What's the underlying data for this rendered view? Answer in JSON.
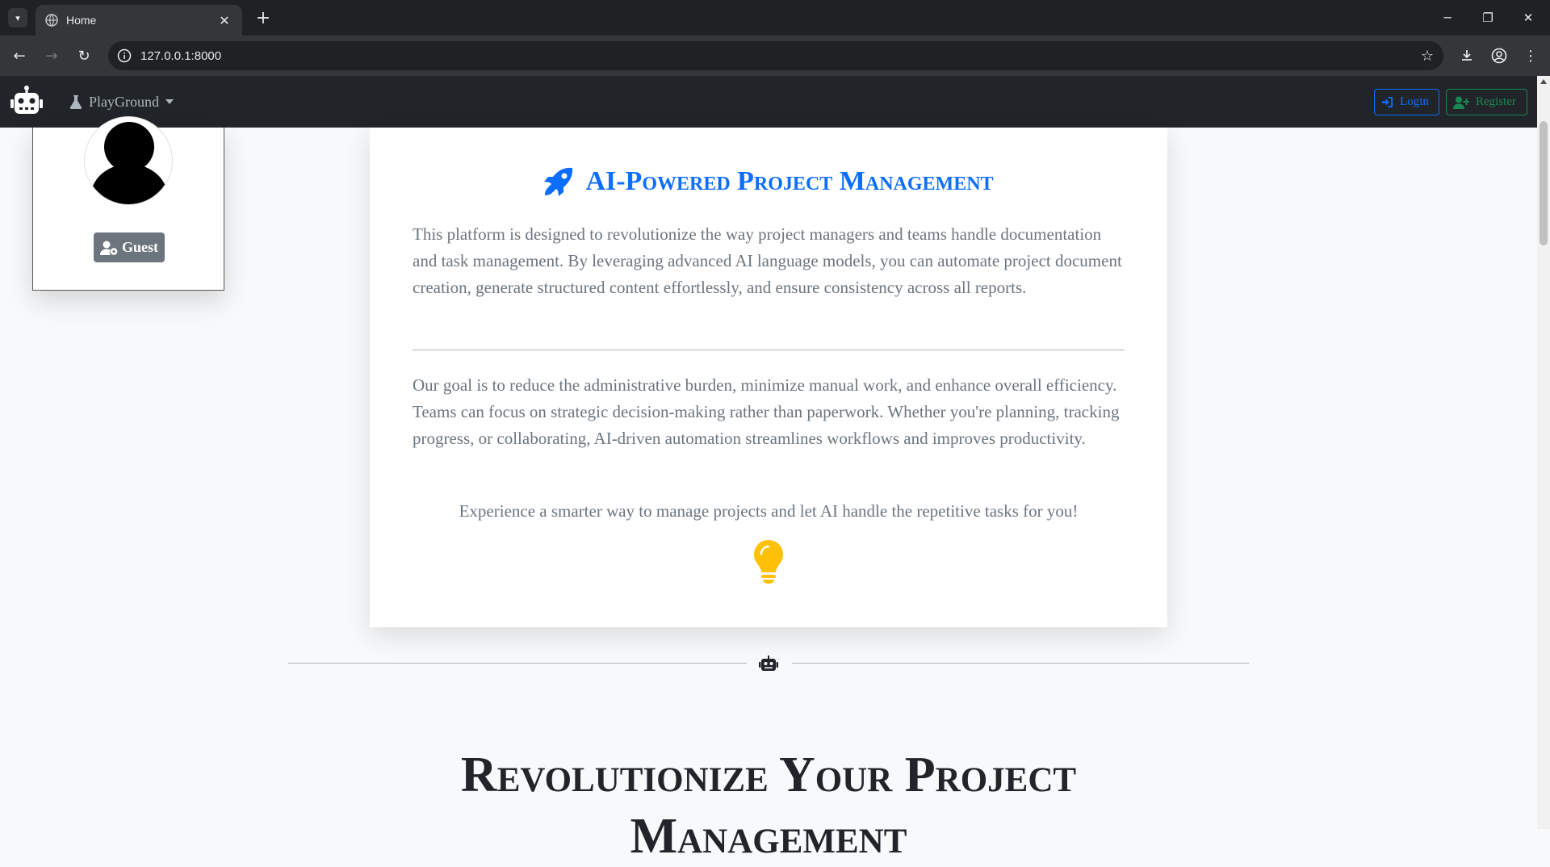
{
  "browser": {
    "tab_title": "Home",
    "url": "127.0.0.1:8000"
  },
  "navbar": {
    "dropdown_label": "PlayGround",
    "login_label": "Login",
    "register_label": "Register"
  },
  "profile": {
    "badge_label": "Guest"
  },
  "main_card": {
    "title": "AI-Powered Project Management",
    "paragraph_1": "This platform is designed to revolutionize the way project managers and teams handle documentation and task management. By leveraging advanced AI language models, you can automate project document creation, generate structured content effortlessly, and ensure consistency across all reports.",
    "paragraph_2": "Our goal is to reduce the administrative burden, minimize manual work, and enhance overall efficiency. Teams can focus on strategic decision-making rather than paperwork. Whether you're planning, tracking progress, or collaborating, AI-driven automation streamlines workflows and improves productivity.",
    "cta": "Experience a smarter way to manage projects and let AI handle the repetitive tasks for you!"
  },
  "section": {
    "heading": "Revolutionize Your Project Management"
  },
  "colors": {
    "primary": "#0d6efd",
    "success": "#198754",
    "navbar_bg": "#212529",
    "muted_text": "#6c757d",
    "bulb": "#ffc107"
  },
  "icons": [
    "robot-icon",
    "flask-icon",
    "login-icon",
    "user-plus-icon",
    "user-icon",
    "user-gear-icon",
    "rocket-icon",
    "lightbulb-icon"
  ]
}
